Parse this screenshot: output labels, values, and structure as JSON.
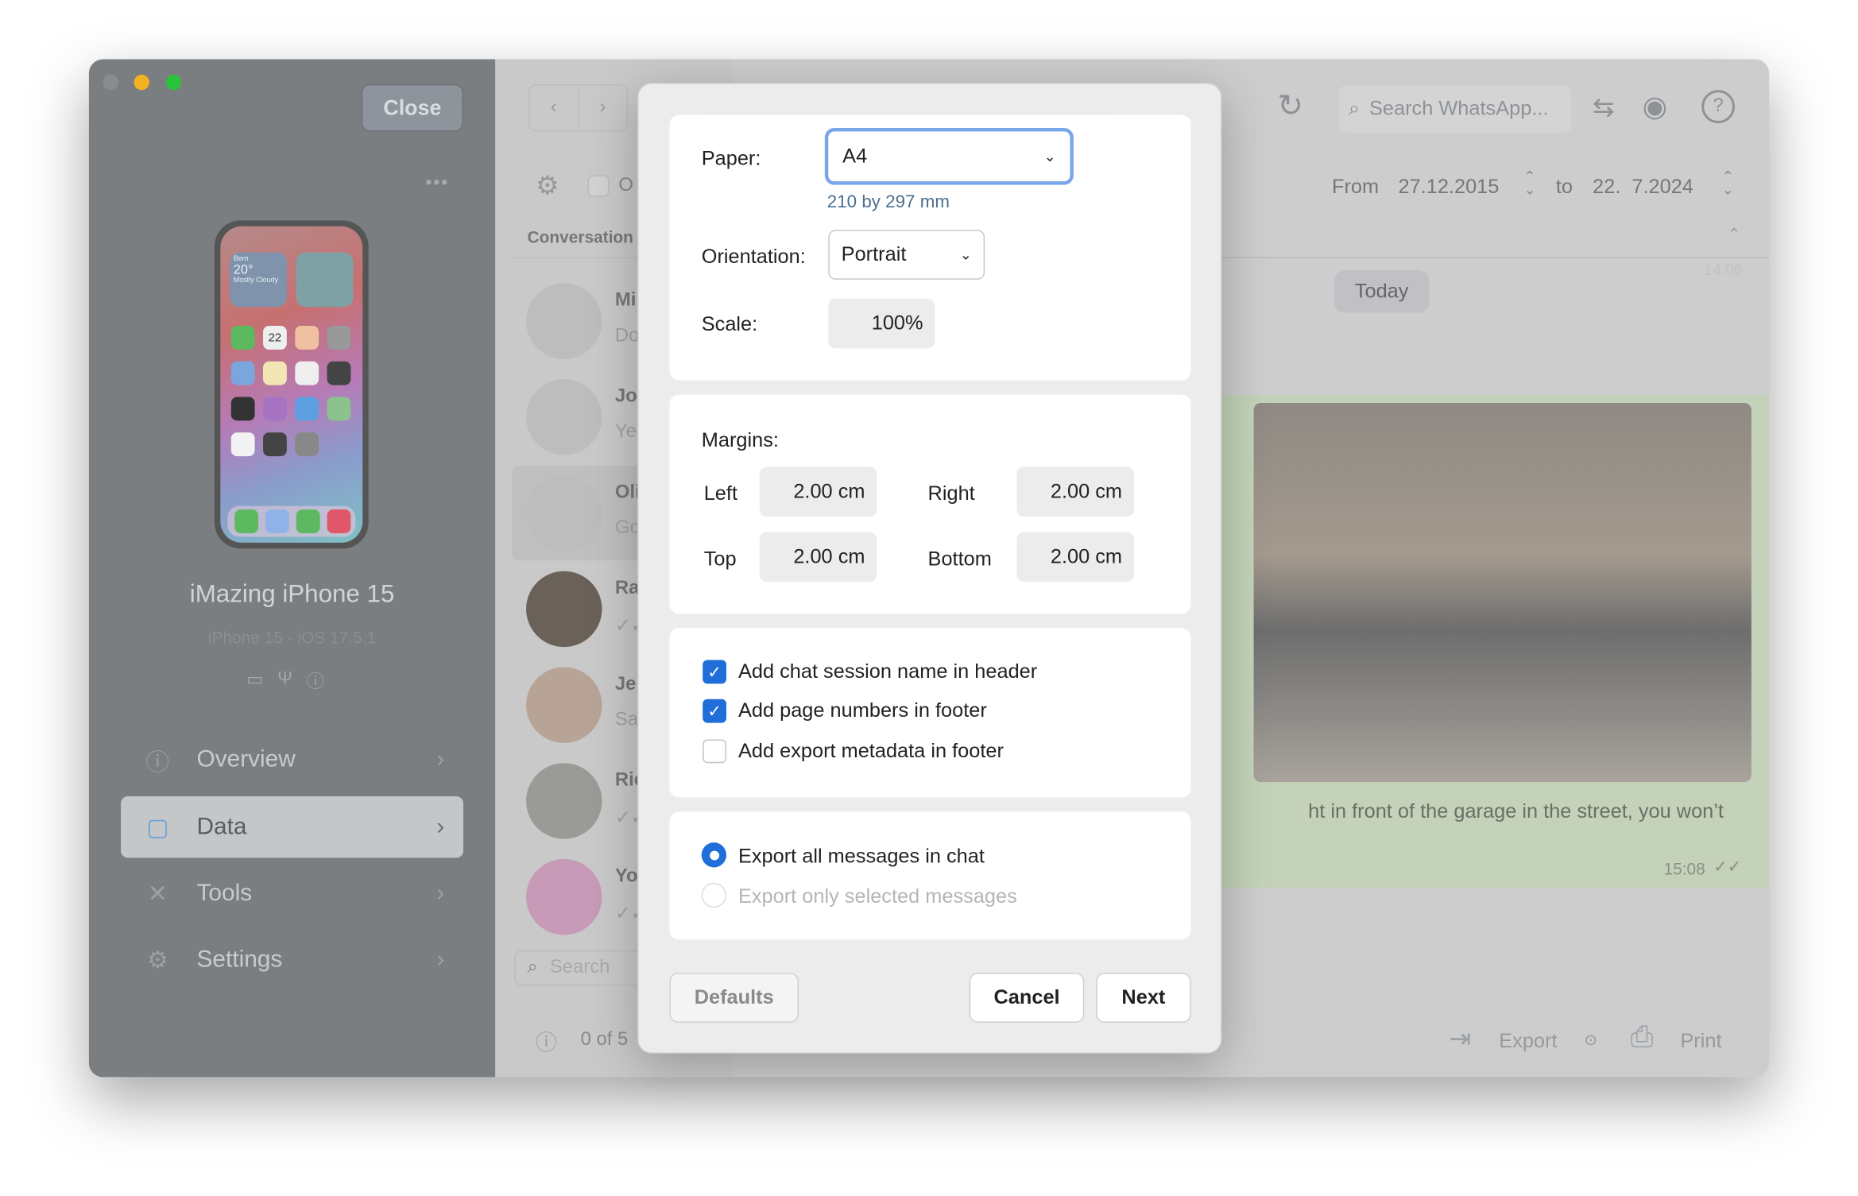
{
  "sidebar": {
    "close_label": "Close",
    "device_name": "iMazing iPhone 15",
    "device_sub": "iPhone 15 - iOS 17.5.1",
    "phone_widget": {
      "city": "Bern",
      "temp": "20°",
      "cond": "Mostly Cloudy",
      "calendar_day": "22"
    },
    "items": [
      {
        "label": "Overview",
        "icon": "info-icon"
      },
      {
        "label": "Data",
        "icon": "square-icon",
        "selected": true
      },
      {
        "label": "Tools",
        "icon": "tools-icon"
      },
      {
        "label": "Settings",
        "icon": "gear-icon"
      }
    ]
  },
  "conversations": {
    "header": "Conversation",
    "toolbar_checkbox_label": "O",
    "items": [
      {
        "name": "Mi",
        "preview": "Do"
      },
      {
        "name": "Jo",
        "preview": "Ye"
      },
      {
        "name": "Oli",
        "preview": "Go",
        "selected": true
      },
      {
        "name": "Ra",
        "preview": "✓✓"
      },
      {
        "name": "Je",
        "preview": "Sa"
      },
      {
        "name": "Ric",
        "preview": "✓✓"
      },
      {
        "name": "Yo",
        "preview": "✓✓"
      }
    ],
    "search_placeholder": "Search",
    "count": "0 of 5"
  },
  "chat": {
    "search_placeholder": "Search WhatsApp...",
    "from_label": "From",
    "from_date": "27.12.2015",
    "to_label": "to",
    "to_date": "22.  7.2024",
    "today_label": "Today",
    "faded_time": "14:06",
    "message_text": "ht in front of the garage in the street, you won’t",
    "message_time": "15:08",
    "export_label": "Export",
    "print_label": "Print"
  },
  "dialog": {
    "paper_label": "Paper:",
    "paper_value": "A4",
    "paper_size": "210 by 297 mm",
    "orientation_label": "Orientation:",
    "orientation_value": "Portrait",
    "scale_label": "Scale:",
    "scale_value": "100%",
    "margins_label": "Margins:",
    "left_label": "Left",
    "left_value": "2.00 cm",
    "right_label": "Right",
    "right_value": "2.00 cm",
    "top_label": "Top",
    "top_value": "2.00 cm",
    "bottom_label": "Bottom",
    "bottom_value": "2.00 cm",
    "options": [
      {
        "label": "Add chat session name in header",
        "checked": true
      },
      {
        "label": "Add page numbers in footer",
        "checked": true
      },
      {
        "label": "Add export metadata in footer",
        "checked": false
      }
    ],
    "radios": [
      {
        "label": "Export all messages in chat",
        "selected": true,
        "enabled": true
      },
      {
        "label": "Export only selected messages",
        "selected": false,
        "enabled": false
      }
    ],
    "defaults_label": "Defaults",
    "cancel_label": "Cancel",
    "next_label": "Next"
  },
  "colors": {
    "accent": "#1f6ed9",
    "chat_bubble": "#c3d2b8"
  }
}
